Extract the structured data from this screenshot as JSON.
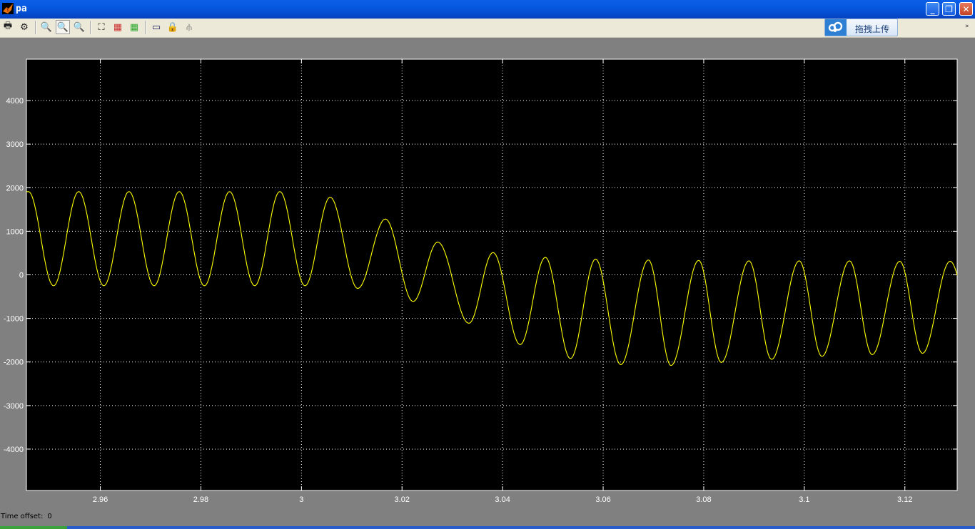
{
  "window": {
    "title": "pa",
    "app_icon": "matlab-icon",
    "controls": {
      "minimize": "_",
      "restore": "❐",
      "close": "✕"
    }
  },
  "toolbar": {
    "buttons": [
      {
        "name": "print-icon",
        "glyph": "🖶"
      },
      {
        "name": "parameters-icon",
        "glyph": "⚙"
      },
      {
        "name": "zoom-icon",
        "glyph": "🔍"
      },
      {
        "name": "zoom-x-icon",
        "glyph": "🔍"
      },
      {
        "name": "zoom-y-icon",
        "glyph": "🔍"
      },
      {
        "name": "autoscale-icon",
        "glyph": "⛶"
      },
      {
        "name": "save-axes-icon",
        "glyph": "▦"
      },
      {
        "name": "restore-axes-icon",
        "glyph": "▦"
      },
      {
        "name": "floating-scope-icon",
        "glyph": "▭"
      },
      {
        "name": "lock-axes-icon",
        "glyph": "🔒"
      },
      {
        "name": "signal-selector-icon",
        "glyph": "⫛"
      }
    ],
    "upload_label": "拖拽上传",
    "overflow_glyph": "»"
  },
  "footer": {
    "time_offset_label": "Time offset:",
    "time_offset_value": "0"
  },
  "colors": {
    "plot_background": "#000000",
    "signal": "#ffff00",
    "grid": "#ffffff",
    "figure_background": "#808080"
  },
  "chart_data": {
    "type": "line",
    "title": "",
    "xlabel": "",
    "ylabel": "",
    "xlim": [
      2.9453,
      3.1304
    ],
    "ylim": [
      -4950,
      4950
    ],
    "xticks": [
      2.96,
      2.98,
      3,
      3.02,
      3.04,
      3.06,
      3.08,
      3.1,
      3.12
    ],
    "xtick_labels": [
      "2.96",
      "2.98",
      "3",
      "3.02",
      "3.04",
      "3.06",
      "3.08",
      "3.1",
      "3.12"
    ],
    "yticks": [
      4000,
      3000,
      2000,
      1000,
      0,
      -1000,
      -2000,
      -3000,
      -4000
    ],
    "ytick_labels": [
      "4000",
      "3000",
      "2000",
      "1000",
      "0",
      "-1000",
      "-2000",
      "-3000",
      "-4000"
    ],
    "grid": true,
    "signal_model": "sinusoid 100 Hz, offset and amplitude vary over time",
    "offset_points": {
      "t": [
        2.945,
        2.995,
        3.005,
        3.015,
        3.025,
        3.035,
        3.045,
        3.06,
        3.131
      ],
      "offset": [
        830,
        830,
        770,
        500,
        100,
        -320,
        -600,
        -840,
        -750
      ]
    },
    "amplitude_points": {
      "t": [
        2.945,
        2.995,
        3.005,
        3.015,
        3.025,
        3.035,
        3.045,
        3.06,
        3.131
      ],
      "amplitude": [
        1080,
        1080,
        1030,
        800,
        680,
        810,
        990,
        1220,
        1060
      ]
    },
    "phase_reference_t": 2.9557,
    "series": [
      {
        "x_start": 2.9453,
        "x_end": 3.1304,
        "peak_times": [
          2.9557,
          2.9657,
          2.9757,
          2.9857,
          2.9957,
          3.0057,
          3.0167,
          3.0271,
          3.0381,
          3.0485,
          3.0585,
          3.069,
          3.079,
          3.089,
          3.099,
          3.109,
          3.119,
          3.129
        ],
        "peak_values": [
          1910,
          1910,
          1910,
          1910,
          1910,
          1780,
          1280,
          750,
          510,
          400,
          360,
          340,
          330,
          320,
          320,
          320,
          310,
          310
        ],
        "trough_times": [
          2.9507,
          2.9607,
          2.9707,
          2.9807,
          2.9907,
          3.0007,
          3.0112,
          3.0222,
          3.0333,
          3.0435,
          3.0535,
          3.0635,
          3.0735,
          3.0835,
          3.0935,
          3.1035,
          3.1135,
          3.1235
        ],
        "trough_values": [
          -250,
          -250,
          -250,
          -250,
          -250,
          -250,
          -310,
          -610,
          -1110,
          -1600,
          -1920,
          -2060,
          -2080,
          -2010,
          -1940,
          -1870,
          -1830,
          -1800
        ]
      }
    ]
  }
}
